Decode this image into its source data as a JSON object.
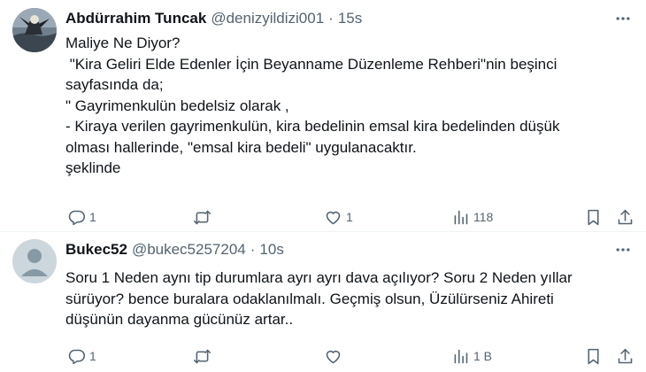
{
  "posts": [
    {
      "author": "Abdürrahim Tuncak",
      "handle": "@denizyildizi001",
      "separator": "·",
      "time": "15s",
      "lines": [
        "Maliye Ne Diyor?",
        " \"Kira Geliri Elde Edenler İçin Beyanname Düzenleme Rehberi\"nin beşinci",
        "sayfasında da;",
        "\" Gayrimenkulün bedelsiz olarak ,",
        "- Kiraya verilen gayrimenkulün, kira bedelinin emsal kira bedelinden düşük",
        "olması hallerinde, \"emsal kira bedeli\" uygulanacaktır.",
        "şeklinde"
      ],
      "replies": "1",
      "retweets": "",
      "likes": "1",
      "views": "118",
      "avatar_icon": "photo-avatar-icon"
    },
    {
      "author": "Bukec52",
      "handle": "@bukec5257204",
      "separator": "·",
      "time": "10s",
      "lines": [
        "Soru 1 Neden aynı tip durumlara ayrı ayrı dava açılıyor? Soru 2 Neden yıllar",
        "sürüyor? bence buralara odaklanılmalı. Geçmiş olsun, Üzülürseniz Ahireti",
        "düşünün dayanma gücünüz artar.."
      ],
      "replies": "1",
      "retweets": "",
      "likes": "",
      "views": "1 B",
      "avatar_icon": "default-avatar-icon"
    }
  ],
  "colors": {
    "text": "#0f1419",
    "muted": "#536471",
    "divider": "#eff3f4",
    "default_avatar_bg": "#ccd6dd"
  }
}
